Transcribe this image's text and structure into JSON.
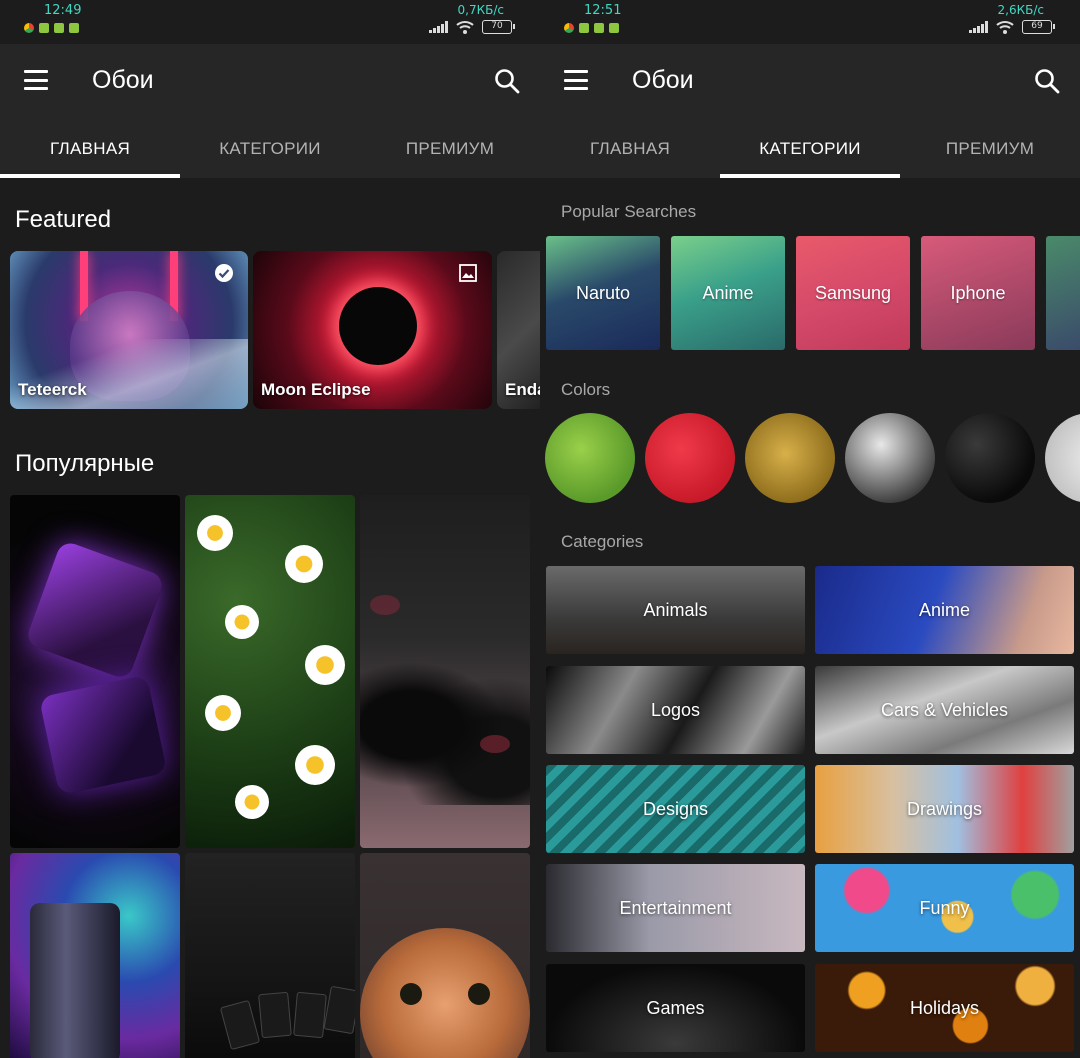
{
  "left_screen": {
    "status": {
      "time": "12:49",
      "speed": "0,7КБ/с",
      "battery": "70"
    },
    "app_title": "Обои",
    "tabs": [
      {
        "label": "ГЛАВНАЯ",
        "active": true
      },
      {
        "label": "КАТЕГОРИИ",
        "active": false
      },
      {
        "label": "ПРЕМИУМ",
        "active": false
      }
    ],
    "featured_title": "Featured",
    "featured": [
      {
        "label": "Teteerck",
        "badge": "verified-icon"
      },
      {
        "label": "Moon Eclipse",
        "badge": "image-icon"
      },
      {
        "label": "Enda"
      }
    ],
    "popular_title": "Популярные"
  },
  "right_screen": {
    "status": {
      "time": "12:51",
      "speed": "2,6КБ/с",
      "battery": "69"
    },
    "app_title": "Обои",
    "tabs": [
      {
        "label": "ГЛАВНАЯ",
        "active": false
      },
      {
        "label": "КАТЕГОРИИ",
        "active": true
      },
      {
        "label": "ПРЕМИУМ",
        "active": false
      }
    ],
    "popular_searches_title": "Popular Searches",
    "popular_searches": [
      "Naruto",
      "Anime",
      "Samsung",
      "Iphone"
    ],
    "colors_title": "Colors",
    "categories_title": "Categories",
    "categories": [
      "Animals",
      "Anime",
      "Logos",
      "Cars & Vehicles",
      "Designs",
      "Drawings",
      "Entertainment",
      "Funny",
      "Games",
      "Holidays"
    ]
  },
  "theme": {
    "accent_status": "#42d7c3",
    "background": "#1c1c1c",
    "appbar": "#262626"
  }
}
